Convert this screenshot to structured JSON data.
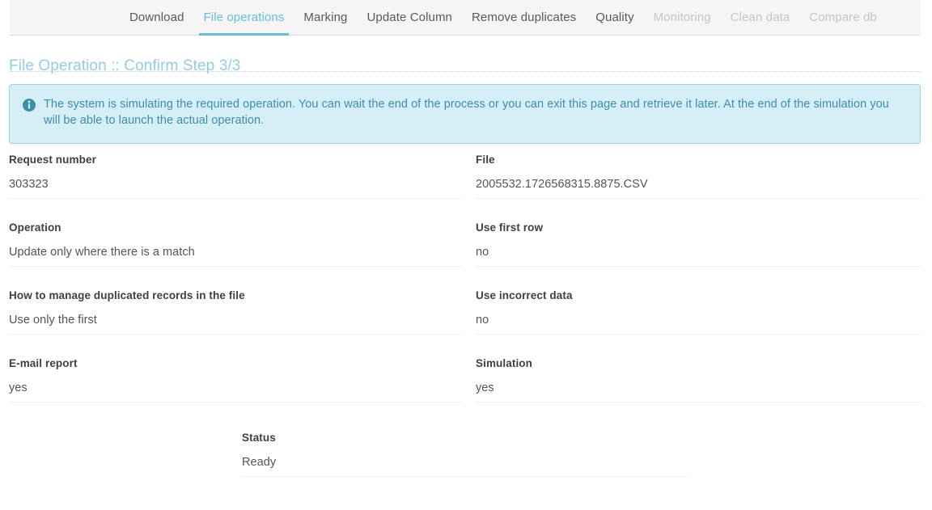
{
  "tabs": [
    {
      "label": "Download",
      "state": "normal"
    },
    {
      "label": "File operations",
      "state": "active"
    },
    {
      "label": "Marking",
      "state": "normal"
    },
    {
      "label": "Update Column",
      "state": "normal"
    },
    {
      "label": "Remove duplicates",
      "state": "normal"
    },
    {
      "label": "Quality",
      "state": "normal"
    },
    {
      "label": "Monitoring",
      "state": "disabled"
    },
    {
      "label": "Clean data",
      "state": "disabled"
    },
    {
      "label": "Compare db",
      "state": "disabled"
    }
  ],
  "page": {
    "title": "File Operation :: Confirm Step 3/3"
  },
  "alert": {
    "icon": "info-circle-icon",
    "text": "The system is simulating the required operation. You can wait the end of the process or you can exit this page and retrieve it later. At the end of the simulation you will be able to launch the actual operation."
  },
  "fields": {
    "request_number": {
      "label": "Request number",
      "value": "303323"
    },
    "file": {
      "label": "File",
      "value": "2005532.1726568315.8875.CSV"
    },
    "operation": {
      "label": "Operation",
      "value": "Update only where there is a match"
    },
    "use_first_row": {
      "label": "Use first row",
      "value": "no"
    },
    "duplicates": {
      "label": "How to manage duplicated records in the file",
      "value": "Use only the first"
    },
    "use_incorrect": {
      "label": "Use incorrect data",
      "value": "no"
    },
    "email_report": {
      "label": "E-mail report",
      "value": "yes"
    },
    "simulation": {
      "label": "Simulation",
      "value": "yes"
    },
    "status": {
      "label": "Status",
      "value": "Ready"
    }
  },
  "colors": {
    "accent": "#62c0d8",
    "title": "#8fd0e0",
    "alert_bg": "#d6eef6",
    "alert_border": "#97d3e5",
    "alert_text": "#3a90ab",
    "tab_text": "#555a60",
    "tab_disabled": "#c2c6ca",
    "header_bg": "#f5f5f5"
  }
}
